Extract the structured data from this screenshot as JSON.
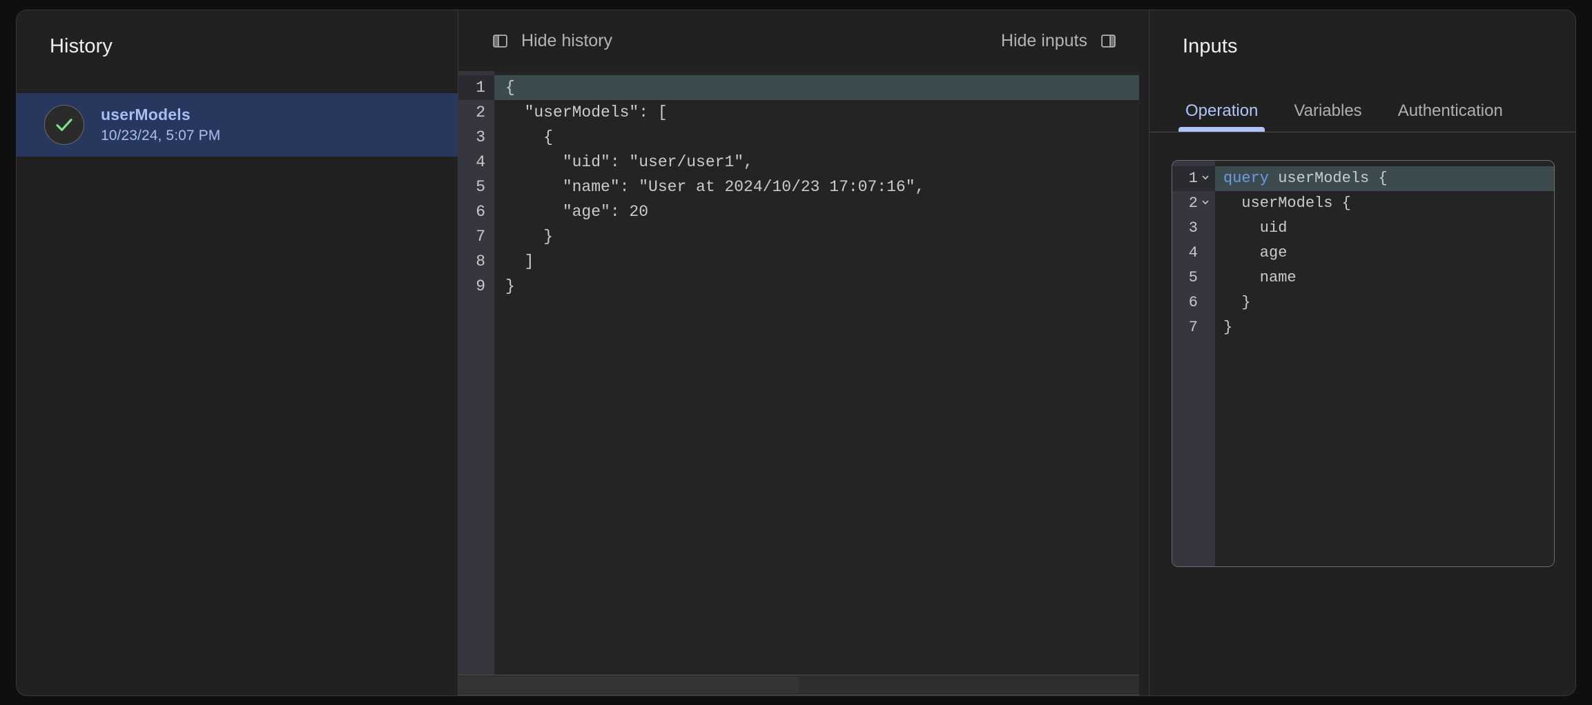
{
  "history": {
    "title": "History",
    "items": [
      {
        "name": "userModels",
        "timestamp": "10/23/24, 5:07 PM",
        "status_icon": "check-circle-icon",
        "selected": true
      }
    ]
  },
  "toolbar": {
    "hide_history_label": "Hide history",
    "hide_history_icon": "panel-left-icon",
    "hide_inputs_label": "Hide inputs",
    "hide_inputs_icon": "panel-right-icon"
  },
  "response": {
    "line_numbers": [
      "1",
      "2",
      "3",
      "4",
      "5",
      "6",
      "7",
      "8",
      "9"
    ],
    "lines": [
      "{",
      "  \"userModels\": [",
      "    {",
      "      \"uid\": \"user/user1\",",
      "      \"name\": \"User at 2024/10/23 17:07:16\",",
      "      \"age\": 20",
      "    }",
      "  ]",
      "}"
    ],
    "active_line": 1
  },
  "inputs": {
    "title": "Inputs",
    "tabs": [
      {
        "label": "Operation",
        "active": true
      },
      {
        "label": "Variables",
        "active": false
      },
      {
        "label": "Authentication",
        "active": false
      }
    ],
    "query": {
      "line_numbers": [
        "1",
        "2",
        "3",
        "4",
        "5",
        "6",
        "7"
      ],
      "lines": [
        {
          "keyword": "query",
          "rest": " userModels {",
          "fold": true
        },
        {
          "keyword": "",
          "rest": "  userModels {",
          "fold": true
        },
        {
          "keyword": "",
          "rest": "    uid",
          "fold": false
        },
        {
          "keyword": "",
          "rest": "    age",
          "fold": false
        },
        {
          "keyword": "",
          "rest": "    name",
          "fold": false
        },
        {
          "keyword": "",
          "rest": "  }",
          "fold": false
        },
        {
          "keyword": "",
          "rest": "}",
          "fold": false
        }
      ],
      "active_line": 1
    }
  },
  "colors": {
    "background": "#0f0f0f",
    "panel": "#212121",
    "selected_history": "#27375e",
    "accent_blue": "#a9bdf0",
    "tab_active": "#aec5f5",
    "check_green": "#7ee08a",
    "editor_active_line": "#3b4b4e",
    "gutter": "#36363f",
    "keyword": "#6f9ae8"
  }
}
